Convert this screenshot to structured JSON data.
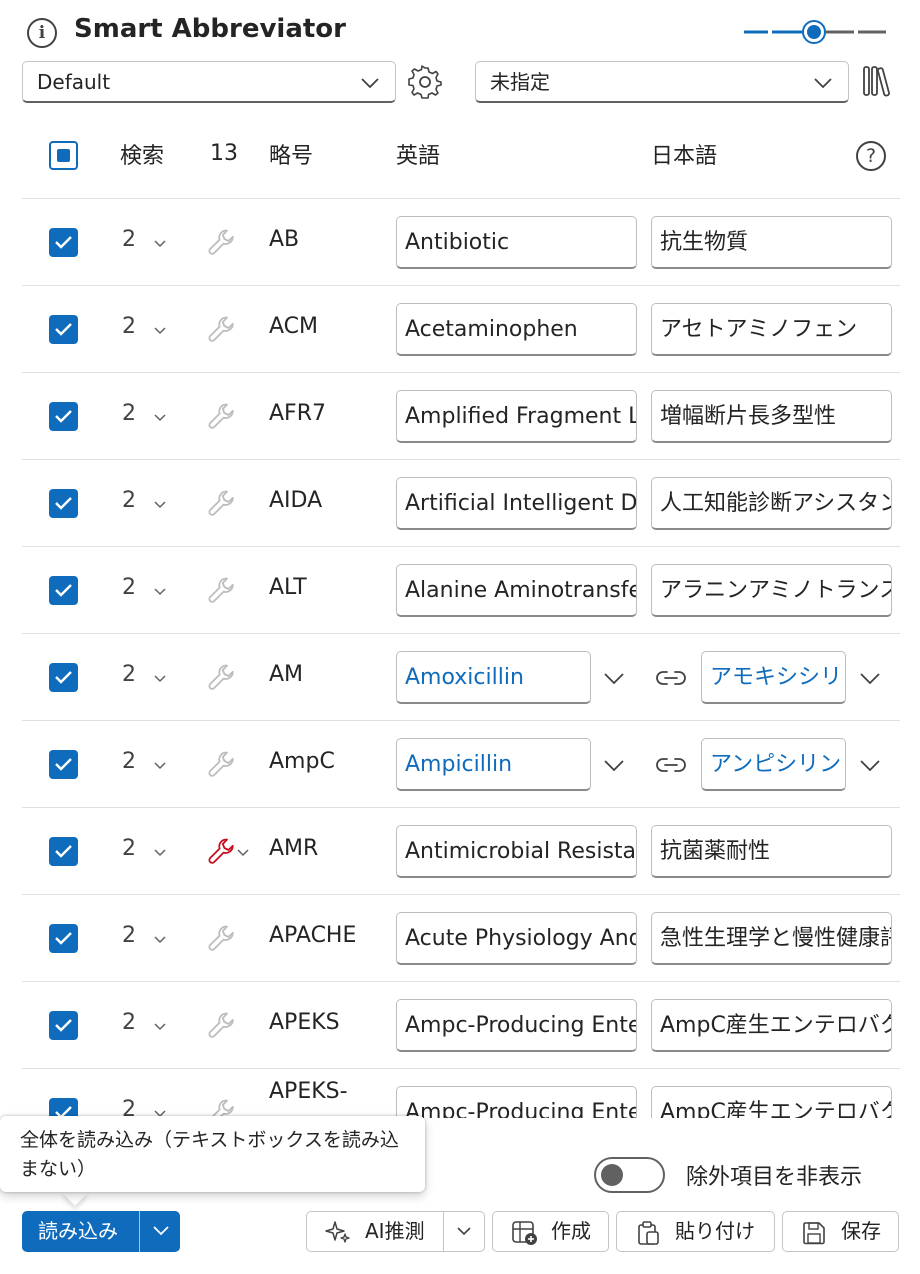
{
  "header": {
    "title": "Smart Abbreviator",
    "info_icon": "info-icon",
    "slider_icon": "slider-icon"
  },
  "toolbar": {
    "profile_select": "Default",
    "settings_icon": "gear-icon",
    "category_select": "未指定",
    "library_icon": "library-icon"
  },
  "table": {
    "headers": {
      "search": "検索",
      "count": "13",
      "abbr": "略号",
      "english": "英語",
      "japanese": "日本語"
    },
    "help_icon": "?",
    "rows": [
      {
        "checked": true,
        "count": "2",
        "abbr": "AB",
        "english": "Antibiotic",
        "japanese": "抗生物質",
        "mode": "text",
        "wrench_active": false
      },
      {
        "checked": true,
        "count": "2",
        "abbr": "ACM",
        "english": "Acetaminophen",
        "japanese": "アセトアミノフェン",
        "mode": "text",
        "wrench_active": false
      },
      {
        "checked": true,
        "count": "2",
        "abbr": "AFR7",
        "english": "Amplified Fragment Length Polymorphism",
        "japanese": "増幅断片長多型性",
        "mode": "text",
        "wrench_active": false
      },
      {
        "checked": true,
        "count": "2",
        "abbr": "AIDA",
        "english": "Artificial Intelligent Diagnostic Assistant",
        "japanese": "人工知能診断アシスタント",
        "mode": "text",
        "wrench_active": false
      },
      {
        "checked": true,
        "count": "2",
        "abbr": "ALT",
        "english": "Alanine Aminotransferase",
        "japanese": "アラニンアミノトランスフェラーゼ",
        "mode": "text",
        "wrench_active": false
      },
      {
        "checked": true,
        "count": "2",
        "abbr": "AM",
        "english": "Amoxicillin",
        "japanese": "アモキシシリン",
        "mode": "select",
        "wrench_active": false
      },
      {
        "checked": true,
        "count": "2",
        "abbr": "AmpC",
        "english": "Ampicillin",
        "japanese": "アンピシリン",
        "mode": "select",
        "wrench_active": false
      },
      {
        "checked": true,
        "count": "2",
        "abbr": "AMR",
        "english": "Antimicrobial Resistance",
        "japanese": "抗菌薬耐性",
        "mode": "text",
        "wrench_active": true
      },
      {
        "checked": true,
        "count": "2",
        "abbr": "APACHE",
        "english": "Acute Physiology And Chronic Health Evaluation",
        "japanese": "急性生理学と慢性健康評価",
        "mode": "text",
        "wrench_active": false
      },
      {
        "checked": true,
        "count": "2",
        "abbr": "APEKS",
        "english": "Ampc-Producing Enterobacteriaceae",
        "japanese": "AmpC産生エンテロバクター",
        "mode": "text",
        "wrench_active": false
      },
      {
        "checked": true,
        "count": "2",
        "abbr": "APEKS-",
        "english": "Ampc-Producing Enterobacteriaceae",
        "japanese": "AmpC産生エンテロバクター",
        "mode": "text",
        "wrench_active": false
      }
    ]
  },
  "tooltip": {
    "text": "全体を読み込み（テキストボックスを読み込まない）"
  },
  "footer": {
    "toggle_label": "除外項目を非表示",
    "toggle_on": false,
    "load_button": "読み込み",
    "ai_button": "AI推測",
    "create_button": "作成",
    "paste_button": "貼り付け",
    "save_button": "保存"
  },
  "colors": {
    "accent": "#0f6cbd",
    "wrench_active": "#c50f1f",
    "text": "#242424"
  }
}
